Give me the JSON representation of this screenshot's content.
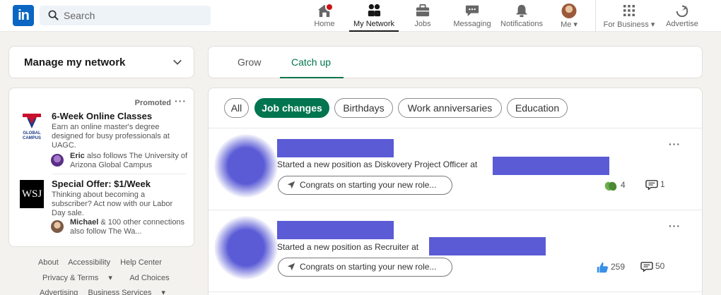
{
  "nav": {
    "logo_text": "in",
    "search_placeholder": "Search",
    "items": [
      {
        "label": "Home"
      },
      {
        "label": "My Network"
      },
      {
        "label": "Jobs"
      },
      {
        "label": "Messaging"
      },
      {
        "label": "Notifications"
      },
      {
        "label": "Me"
      },
      {
        "label": "For Business"
      },
      {
        "label": "Advertise"
      }
    ]
  },
  "sidebar": {
    "manage_title": "Manage my network",
    "promoted_label": "Promoted",
    "ads": [
      {
        "logo_text": "GLOBAL CAMPUS",
        "headline": "6-Week Online Classes",
        "body": "Earn an online master's degree designed for busy professionals at UAGC.",
        "follow_name": "Eric",
        "follow_text": " also follows The University of Arizona Global Campus"
      },
      {
        "logo_text": "WSJ",
        "headline": "Special Offer: $1/Week",
        "body": "Thinking about becoming a subscriber? Act now with our Labor Day sale.",
        "follow_name": "Michael",
        "follow_text": " & 100 other connections also follow The Wa..."
      }
    ],
    "footer": {
      "row1": [
        "About",
        "Accessibility",
        "Help Center"
      ],
      "row2": [
        "Privacy & Terms",
        "Ad Choices"
      ],
      "row3": [
        "Advertising",
        "Business Services"
      ]
    }
  },
  "tabs": {
    "grow": "Grow",
    "catch_up": "Catch up"
  },
  "filters": [
    "All",
    "Job changes",
    "Birthdays",
    "Work anniversaries",
    "Education"
  ],
  "feed": [
    {
      "description": "Started a new position as Diskovery Project Officer at",
      "button": "Congrats on starting your new role...",
      "reactions": "4",
      "comments": "1"
    },
    {
      "description": "Started a new position as Recruiter at",
      "button": "Congrats on starting your new role...",
      "reactions": "259",
      "comments": "50"
    }
  ],
  "colors": {
    "brand": "#0a66c2",
    "accent_green": "#01754f",
    "redaction": "#5b5bd6",
    "notification_badge": "#cc1016"
  }
}
